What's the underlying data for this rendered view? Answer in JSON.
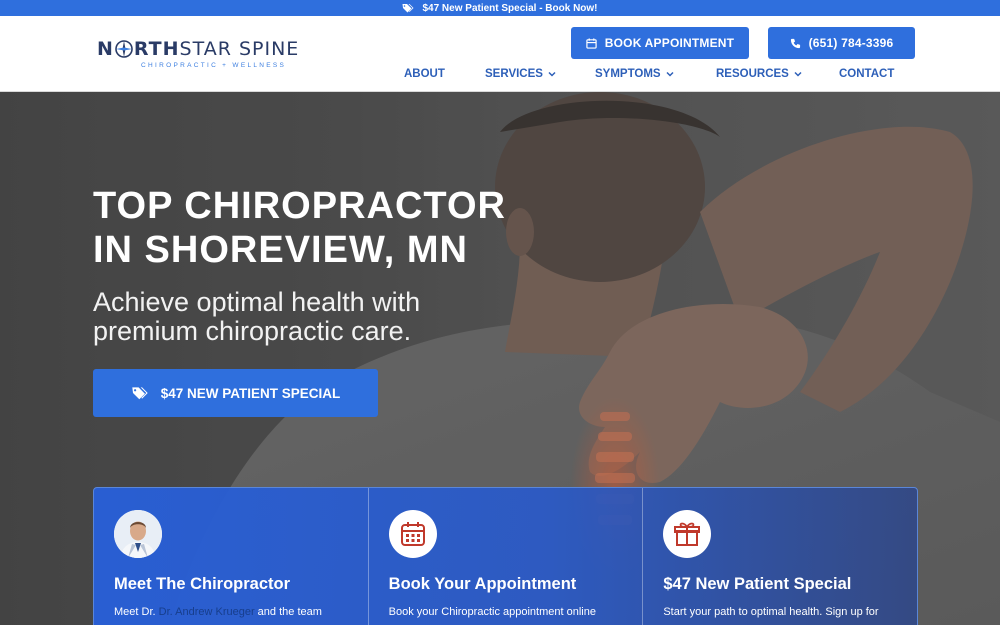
{
  "promo": {
    "text": "$47 New Patient Special - Book Now!",
    "icon": "tags-icon"
  },
  "brand": {
    "name_bold": "NORTH",
    "name_mid": "STAR SPINE",
    "tagline": "CHIROPRACTIC + WELLNESS"
  },
  "header_buttons": {
    "book_label": "BOOK APPOINTMENT",
    "phone_label": "(651) 784-3396"
  },
  "nav": {
    "about": "ABOUT",
    "services": "SERVICES",
    "symptoms": "SYMPTOMS",
    "resources": "RESOURCES",
    "contact": "CONTACT"
  },
  "hero": {
    "title_line1": "TOP CHIROPRACTOR",
    "title_line2": "IN SHOREVIEW, MN",
    "sub_line1": "Achieve optimal health with",
    "sub_line2": "premium chiropractic care.",
    "cta": "$47 NEW PATIENT SPECIAL"
  },
  "cards": [
    {
      "title": "Meet The Chiropractor",
      "text_pre": "Meet Dr. ",
      "text_link": "Dr. Andrew Krueger",
      "text_post": " and the team",
      "icon": "doctor-avatar"
    },
    {
      "title": "Book Your Appointment",
      "text": "Book your Chiropractic appointment online",
      "icon": "calendar-icon"
    },
    {
      "title": "$47 New Patient Special",
      "text": "Start your path to optimal health. Sign up for",
      "icon": "gift-icon"
    }
  ],
  "colors": {
    "primary": "#2f6fdd",
    "nav": "#2d5fb8",
    "logo": "#2a3b66"
  }
}
